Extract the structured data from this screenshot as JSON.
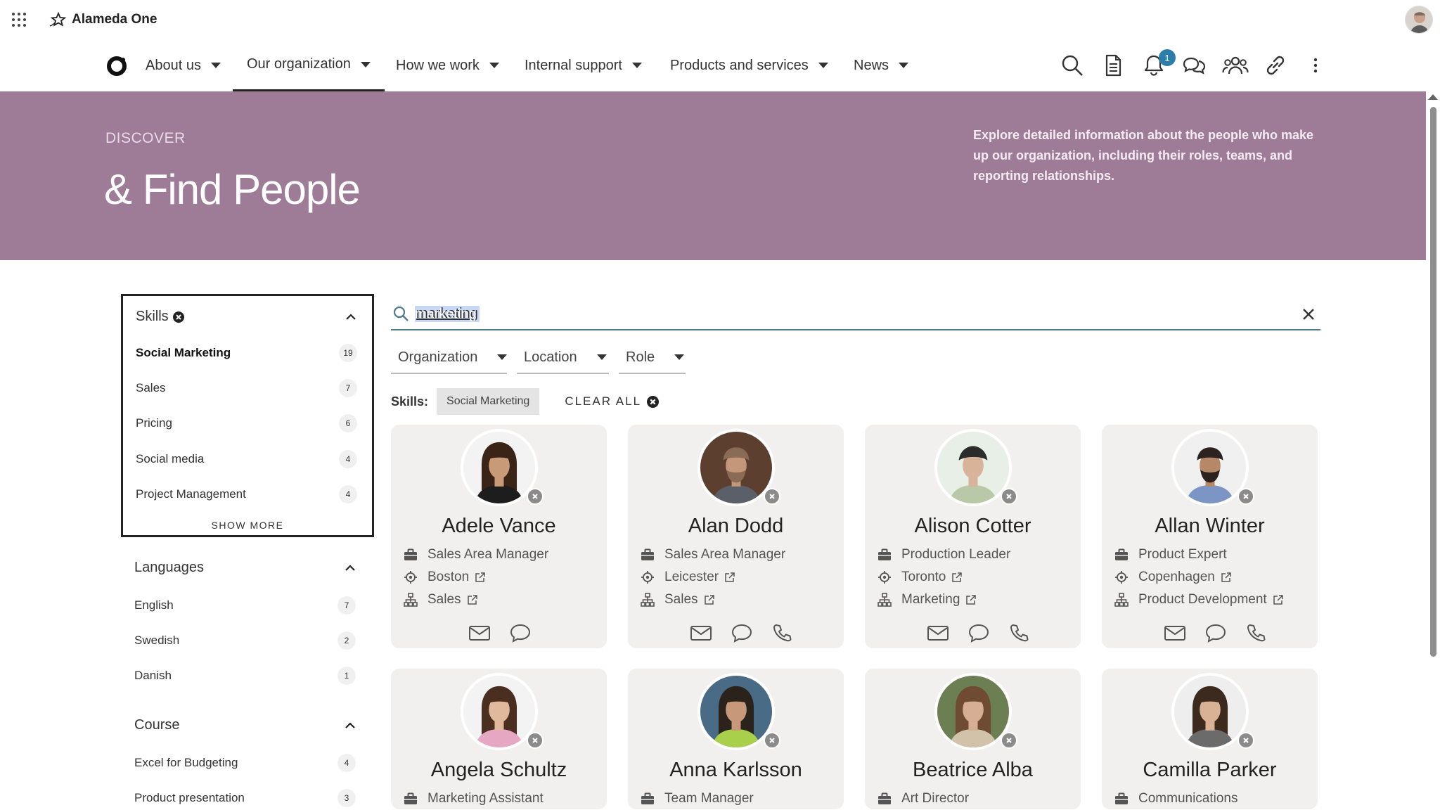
{
  "app": {
    "name": "Alameda One"
  },
  "nav": {
    "items": [
      {
        "label": "About us"
      },
      {
        "label": "Our organization"
      },
      {
        "label": "How we work"
      },
      {
        "label": "Internal support"
      },
      {
        "label": "Products and services"
      },
      {
        "label": "News"
      }
    ],
    "notification_count": "1"
  },
  "hero": {
    "kicker": "DISCOVER",
    "title": "& Find People",
    "description": "Explore detailed information about the people who make up our organization, including their roles, teams, and reporting relationships."
  },
  "filters": {
    "skills": {
      "title": "Skills",
      "items": [
        {
          "label": "Social Marketing",
          "count": "19"
        },
        {
          "label": "Sales",
          "count": "7"
        },
        {
          "label": "Pricing",
          "count": "6"
        },
        {
          "label": "Social media",
          "count": "4"
        },
        {
          "label": "Project Management",
          "count": "4"
        }
      ],
      "show_more": "SHOW MORE"
    },
    "languages": {
      "title": "Languages",
      "items": [
        {
          "label": "English",
          "count": "7"
        },
        {
          "label": "Swedish",
          "count": "2"
        },
        {
          "label": "Danish",
          "count": "1"
        }
      ]
    },
    "course": {
      "title": "Course",
      "items": [
        {
          "label": "Excel for Budgeting",
          "count": "4"
        },
        {
          "label": "Product presentation",
          "count": "3"
        }
      ]
    }
  },
  "search": {
    "value": "marketing"
  },
  "dropdowns": {
    "organization": "Organization",
    "location": "Location",
    "role": "Role"
  },
  "active_filters": {
    "label": "Skills:",
    "chip": "Social Marketing",
    "clear_all": "CLEAR ALL"
  },
  "people": [
    {
      "name": "Adele Vance",
      "title": "Sales Area Manager",
      "location": "Boston",
      "department": "Sales"
    },
    {
      "name": "Alan Dodd",
      "title": "Sales Area Manager",
      "location": "Leicester",
      "department": "Sales"
    },
    {
      "name": "Alison Cotter",
      "title": "Production Leader",
      "location": "Toronto",
      "department": "Marketing"
    },
    {
      "name": "Allan Winter",
      "title": "Product Expert",
      "location": "Copenhagen",
      "department": "Product Development"
    },
    {
      "name": "Angela Schultz",
      "title": "Marketing Assistant"
    },
    {
      "name": "Anna Karlsson",
      "title": "Team Manager"
    },
    {
      "name": "Beatrice Alba",
      "title": "Art Director"
    },
    {
      "name": "Camilla Parker",
      "title": "Communications"
    }
  ],
  "colors": {
    "hero": "#9e7b96",
    "card": "#f2f0ee",
    "accent": "#2a7ea8"
  }
}
